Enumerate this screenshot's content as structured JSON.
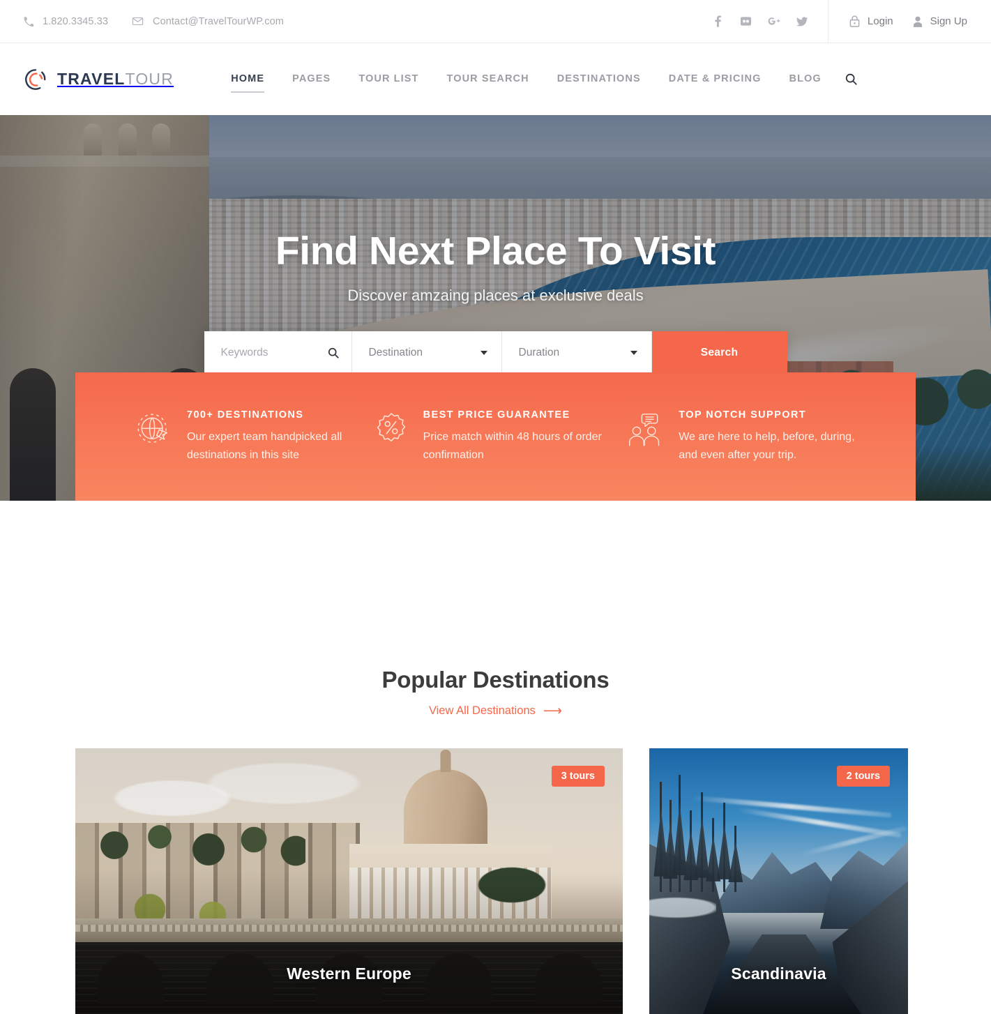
{
  "topbar": {
    "phone": "1.820.3345.33",
    "phone_icon": "phone-icon",
    "email": "Contact@TravelTourWP.com",
    "email_icon": "envelope-icon",
    "social": [
      {
        "name": "facebook-icon",
        "glyph": "f"
      },
      {
        "name": "flickr-icon",
        "glyph": "⁙"
      },
      {
        "name": "google-plus-icon",
        "glyph": "G+"
      },
      {
        "name": "twitter-icon",
        "glyph": "ᴠ"
      }
    ],
    "login_label": "Login",
    "login_icon": "lock-icon",
    "signup_label": "Sign Up",
    "signup_icon": "user-icon"
  },
  "header": {
    "logo": {
      "primary": "TRAVEL",
      "secondary": "TOUR",
      "icon": "circle-swirl-logo-icon"
    },
    "nav": [
      {
        "label": "HOME",
        "active": true
      },
      {
        "label": "PAGES",
        "active": false
      },
      {
        "label": "TOUR LIST",
        "active": false
      },
      {
        "label": "TOUR SEARCH",
        "active": false
      },
      {
        "label": "DESTINATIONS",
        "active": false
      },
      {
        "label": "DATE & PRICING",
        "active": false
      },
      {
        "label": "BLOG",
        "active": false
      }
    ],
    "search_icon": "search-icon"
  },
  "hero": {
    "title": "Find Next Place To Visit",
    "subtitle": "Discover amzaing places at exclusive deals"
  },
  "search": {
    "keywords_placeholder": "Keywords",
    "keywords_value": "",
    "keywords_icon": "search-icon",
    "destination_label": "Destination",
    "duration_label": "Duration",
    "button_label": "Search"
  },
  "features": [
    {
      "icon": "globe-plane-icon",
      "title": "700+ DESTINATIONS",
      "desc": "Our expert team handpicked all destinations in this site"
    },
    {
      "icon": "percent-badge-icon",
      "title": "BEST PRICE GUARANTEE",
      "desc": "Price match within 48 hours of order confirmation"
    },
    {
      "icon": "support-people-icon",
      "title": "TOP NOTCH SUPPORT",
      "desc": "We are here to help, before, during, and even after your trip."
    }
  ],
  "popular": {
    "title": "Popular Destinations",
    "link_label": "View All Destinations",
    "link_arrow": "⟶"
  },
  "destinations": [
    {
      "name": "Western Europe",
      "tours": "3 tours"
    },
    {
      "name": "Scandinavia",
      "tours": "2 tours"
    }
  ],
  "colors": {
    "accent": "#f4674a",
    "accent_light": "#f98660",
    "nav_active": "#36404f",
    "nav_inactive": "#9a9da3",
    "logo_primary": "#2b3a51",
    "logo_secondary": "#9aa0a8",
    "heading": "#3c3c3c",
    "muted_text": "#a6a9ae"
  }
}
